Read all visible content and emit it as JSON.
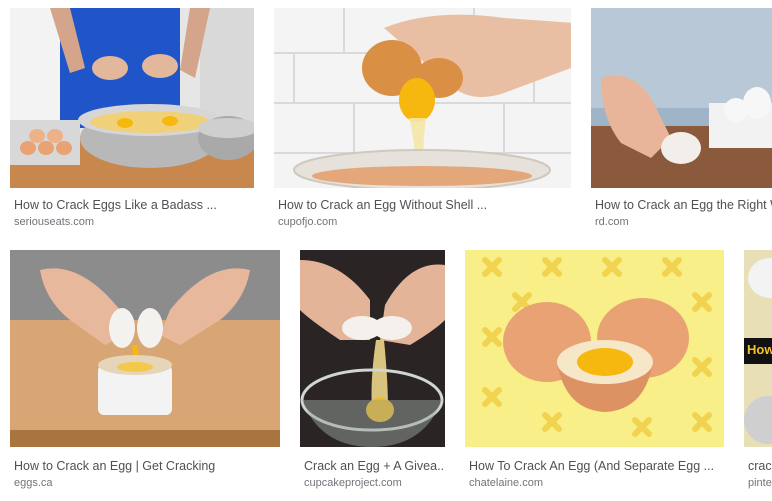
{
  "results": [
    {
      "title": "How to Crack Eggs Like a Badass ...",
      "source": "seriouseats.com"
    },
    {
      "title": "How to Crack an Egg Without Shell ...",
      "source": "cupofjo.com"
    },
    {
      "title": "How to Crack an Egg the Right W",
      "source": "rd.com"
    },
    {
      "title": "How to Crack an Egg | Get Cracking",
      "source": "eggs.ca"
    },
    {
      "title": "Crack an Egg + A Givea...",
      "source": "cupcakeproject.com"
    },
    {
      "title": "How To Crack An Egg (And Separate Egg ...",
      "source": "chatelaine.com"
    },
    {
      "title": "crac",
      "source": "pinte",
      "thumb_text": "How"
    }
  ],
  "colors": {
    "title_text": "#4d5156",
    "source_text": "#70757a",
    "yolk": "#f6b80f",
    "shell": "#e8a274",
    "table_wood": "#c8874d",
    "apron_blue": "#1f55c8",
    "yellow_bg": "#f8ef88"
  },
  "icons": [
    "egg-yolk-icon",
    "egg-shell-icon"
  ]
}
